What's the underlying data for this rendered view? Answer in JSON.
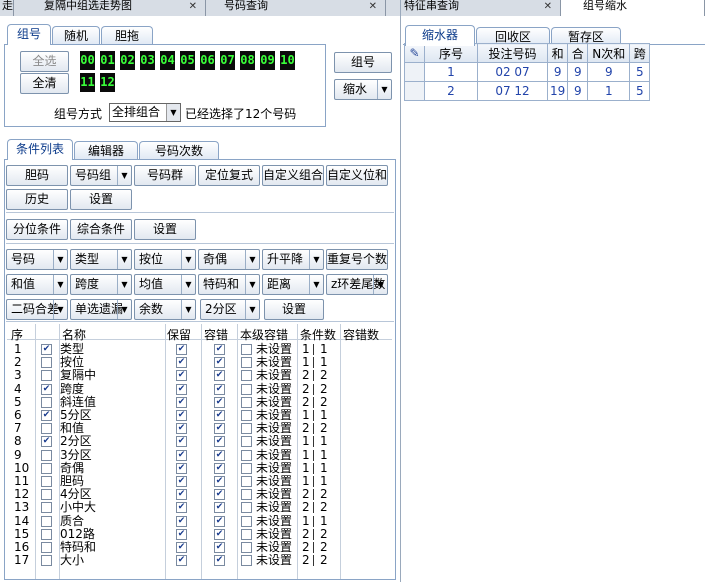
{
  "top_tabs": [
    {
      "label": "走",
      "active": false
    },
    {
      "label": "复隔中组选走势图",
      "active": false
    },
    {
      "label": "号码查询",
      "active": false
    },
    {
      "label": "特征串查询",
      "active": false
    },
    {
      "label": "组号缩水",
      "active": true
    }
  ],
  "left_tabs": [
    "组号",
    "随机",
    "胆拖"
  ],
  "select_all_label": "全选",
  "clear_label": "全清",
  "digits": [
    "00",
    "01",
    "02",
    "03",
    "04",
    "05",
    "06",
    "07",
    "08",
    "09",
    "10",
    "11",
    "12"
  ],
  "group_method_label": "组号方式",
  "group_method_value": "全排组合",
  "selected_text": "已经选择了12个号码",
  "group_button": "组号",
  "shrink_button": "缩水",
  "cond_tabs": [
    "条件列表",
    "编辑器",
    "号码次数"
  ],
  "button_rows": [
    [
      {
        "label": "胆码",
        "dd": false
      },
      {
        "label": "号码组",
        "dd": true
      },
      {
        "label": "号码群",
        "dd": false
      },
      {
        "label": "定位复式",
        "dd": false
      },
      {
        "label": "自定义组合",
        "dd": false
      },
      {
        "label": "自定义位和",
        "dd": false
      }
    ],
    [
      {
        "label": "历史",
        "dd": false
      },
      {
        "label": "设置",
        "dd": false
      }
    ],
    [
      {
        "label": "分位条件",
        "dd": false
      },
      {
        "label": "综合条件",
        "dd": false
      },
      {
        "label": "设置",
        "dd": false
      }
    ],
    [
      {
        "label": "号码",
        "dd": true
      },
      {
        "label": "类型",
        "dd": true
      },
      {
        "label": "按位",
        "dd": true
      },
      {
        "label": "奇偶",
        "dd": true
      },
      {
        "label": "升平降",
        "dd": true
      },
      {
        "label": "重复号个数",
        "dd": false
      }
    ],
    [
      {
        "label": "和值",
        "dd": true
      },
      {
        "label": "跨度",
        "dd": true
      },
      {
        "label": "均值",
        "dd": true
      },
      {
        "label": "特码和",
        "dd": true
      },
      {
        "label": "距离",
        "dd": true
      },
      {
        "label": "z环差尾数",
        "dd": true
      }
    ],
    [
      {
        "label": "二码合差",
        "dd": true
      },
      {
        "label": "单选遗漏",
        "dd": true
      },
      {
        "label": "余数",
        "dd": true
      },
      {
        "label": "2分区",
        "dd": true
      },
      {
        "label": "设置",
        "dd": false
      }
    ]
  ],
  "cond_headers": [
    "序",
    "名称",
    "保留",
    "容错",
    "本级容错",
    "条件数",
    "容错数"
  ],
  "conditions": [
    {
      "n": "1",
      "name": "类型",
      "checked": true,
      "keep": true,
      "tol": true,
      "lvl": "未设置",
      "c": "1",
      "t": "1"
    },
    {
      "n": "2",
      "name": "按位",
      "checked": false,
      "keep": true,
      "tol": true,
      "lvl": "未设置",
      "c": "1",
      "t": "1"
    },
    {
      "n": "3",
      "name": "复隔中",
      "checked": false,
      "keep": true,
      "tol": true,
      "lvl": "未设置",
      "c": "2",
      "t": "2"
    },
    {
      "n": "4",
      "name": "跨度",
      "checked": true,
      "keep": true,
      "tol": true,
      "lvl": "未设置",
      "c": "2",
      "t": "2"
    },
    {
      "n": "5",
      "name": "斜连值",
      "checked": false,
      "keep": true,
      "tol": true,
      "lvl": "未设置",
      "c": "2",
      "t": "2"
    },
    {
      "n": "6",
      "name": "5分区",
      "checked": true,
      "keep": true,
      "tol": true,
      "lvl": "未设置",
      "c": "1",
      "t": "1"
    },
    {
      "n": "7",
      "name": "和值",
      "checked": false,
      "keep": true,
      "tol": true,
      "lvl": "未设置",
      "c": "2",
      "t": "2"
    },
    {
      "n": "8",
      "name": "2分区",
      "checked": true,
      "keep": true,
      "tol": true,
      "lvl": "未设置",
      "c": "1",
      "t": "1"
    },
    {
      "n": "9",
      "name": "3分区",
      "checked": false,
      "keep": true,
      "tol": true,
      "lvl": "未设置",
      "c": "1",
      "t": "1"
    },
    {
      "n": "10",
      "name": "奇偶",
      "checked": false,
      "keep": true,
      "tol": true,
      "lvl": "未设置",
      "c": "1",
      "t": "1"
    },
    {
      "n": "11",
      "name": "胆码",
      "checked": false,
      "keep": true,
      "tol": true,
      "lvl": "未设置",
      "c": "1",
      "t": "1"
    },
    {
      "n": "12",
      "name": "4分区",
      "checked": false,
      "keep": true,
      "tol": true,
      "lvl": "未设置",
      "c": "2",
      "t": "2"
    },
    {
      "n": "13",
      "name": "小中大",
      "checked": false,
      "keep": true,
      "tol": true,
      "lvl": "未设置",
      "c": "2",
      "t": "2"
    },
    {
      "n": "14",
      "name": "质合",
      "checked": false,
      "keep": true,
      "tol": true,
      "lvl": "未设置",
      "c": "1",
      "t": "1"
    },
    {
      "n": "15",
      "name": "012路",
      "checked": false,
      "keep": true,
      "tol": true,
      "lvl": "未设置",
      "c": "2",
      "t": "2"
    },
    {
      "n": "16",
      "name": "特码和",
      "checked": false,
      "keep": true,
      "tol": true,
      "lvl": "未设置",
      "c": "2",
      "t": "2"
    },
    {
      "n": "17",
      "name": "大小",
      "checked": false,
      "keep": true,
      "tol": true,
      "lvl": "未设置",
      "c": "2",
      "t": "2"
    }
  ],
  "right_tabs": [
    "缩水器",
    "回收区",
    "暂存区"
  ],
  "grid_headers": [
    "序号",
    "投注号码",
    "和",
    "合",
    "N次和",
    "跨"
  ],
  "grid_rows": [
    [
      "1",
      "02 07",
      "9",
      "9",
      "9",
      "5"
    ],
    [
      "2",
      "07 12",
      "19",
      "9",
      "1",
      "5"
    ]
  ]
}
